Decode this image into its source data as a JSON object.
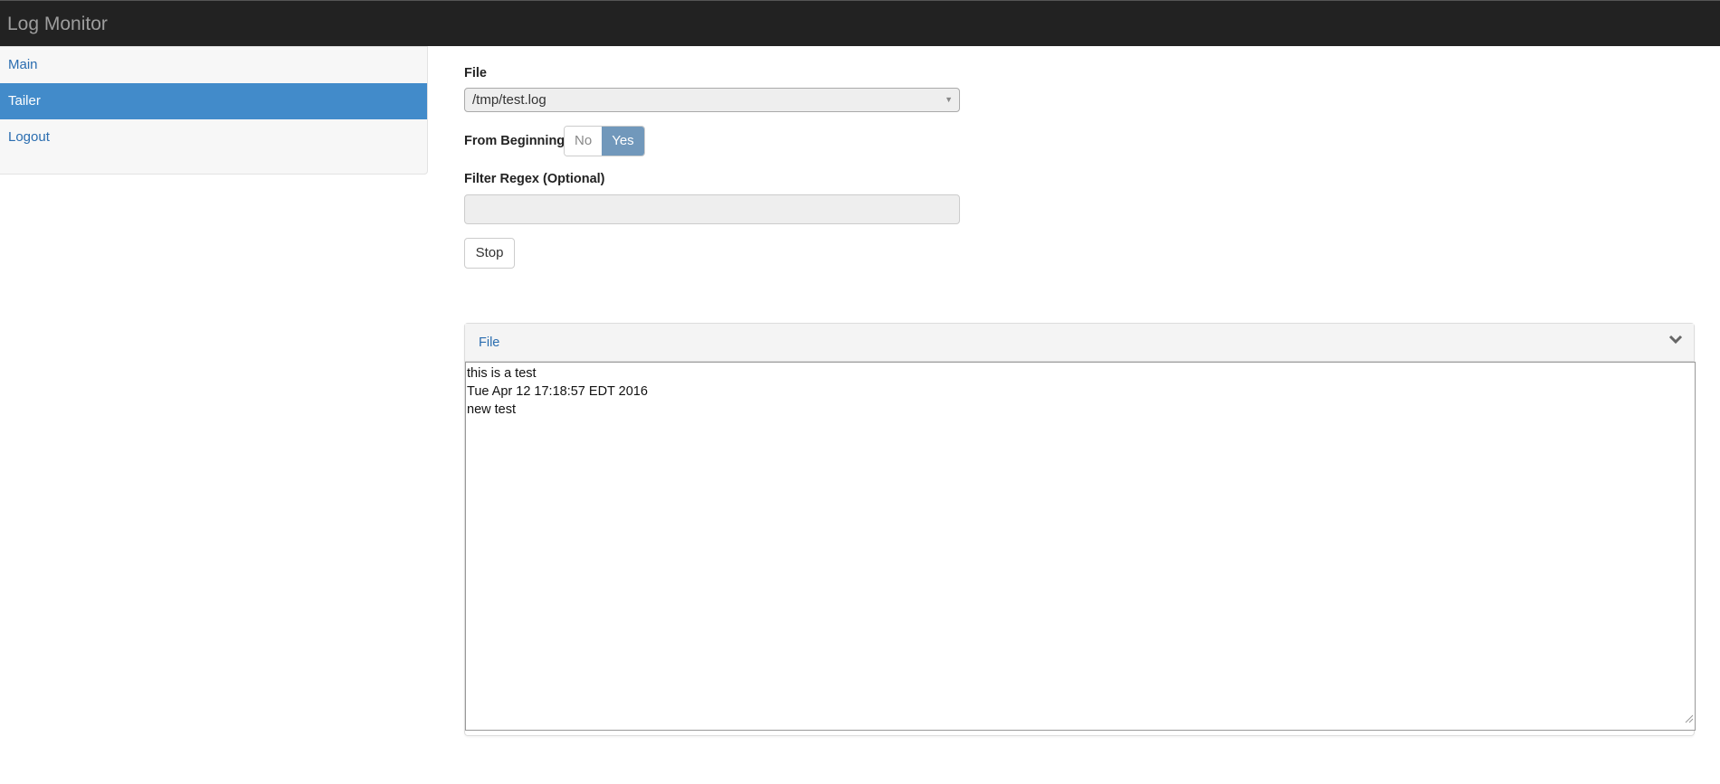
{
  "navbar": {
    "title": "Log Monitor"
  },
  "sidebar": {
    "items": [
      {
        "label": "Main"
      },
      {
        "label": "Tailer"
      },
      {
        "label": "Logout"
      }
    ]
  },
  "form": {
    "file_label": "File",
    "file_value": "/tmp/test.log",
    "from_beginning_label": "From Beginning",
    "from_beginning_options": [
      "No",
      "Yes"
    ],
    "from_beginning_selected": "Yes",
    "filter_label": "Filter Regex (Optional)",
    "filter_value": "",
    "stop_label": "Stop"
  },
  "panel": {
    "title": "File",
    "lines": [
      "this is a test",
      "Tue Apr 12 17:18:57 EDT 2016",
      "new test"
    ]
  },
  "colors": {
    "navbar": "#222222",
    "active": "#428bca",
    "toggle_on": "#7198bb",
    "link": "#2a6db0"
  }
}
